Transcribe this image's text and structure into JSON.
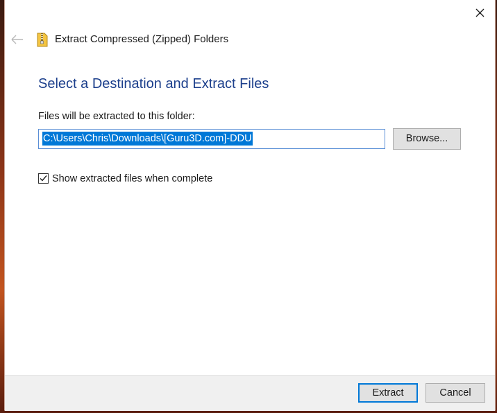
{
  "window": {
    "title": "Extract Compressed (Zipped) Folders"
  },
  "main": {
    "heading": "Select a Destination and Extract Files",
    "destination_label": "Files will be extracted to this folder:",
    "destination_path": "C:\\Users\\Chris\\Downloads\\[Guru3D.com]-DDU",
    "browse_label": "Browse...",
    "show_files_label": "Show extracted files when complete",
    "show_files_checked": true
  },
  "footer": {
    "extract_label": "Extract",
    "cancel_label": "Cancel"
  },
  "icons": {
    "back": "back-arrow-icon",
    "folder": "zip-folder-icon",
    "close": "close-icon",
    "check": "checkmark-icon"
  },
  "colors": {
    "heading": "#1c3f8c",
    "selection": "#0078d7",
    "default_button_border": "#0078d7"
  }
}
